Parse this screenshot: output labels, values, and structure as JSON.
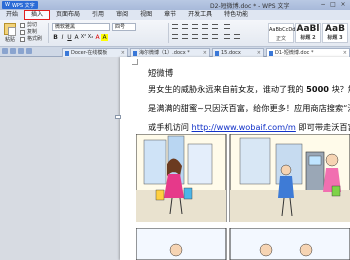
{
  "titlebar": {
    "app_name": "WPS 文字",
    "doc_title": "D2-短微博.doc * - WPS 文字",
    "min": "−",
    "max": "□",
    "close": "×"
  },
  "menu": {
    "items": [
      "开始",
      "插入",
      "页面布局",
      "引用",
      "审阅",
      "视图",
      "章节",
      "开发工具",
      "特色功能"
    ],
    "active_index": 1
  },
  "ribbon": {
    "paste_label": "粘贴",
    "cut_label": "剪切",
    "copy_label": "复制",
    "format_painter_label": "格式刷",
    "font_name": "微软雅黑",
    "font_size": "四号",
    "format_buttons": [
      "B",
      "I",
      "U",
      "A",
      "X²",
      "X₂",
      "A",
      "A"
    ],
    "styles": [
      {
        "preview": "AaBbCcDd",
        "name": "正文"
      },
      {
        "preview": "AaBbCcDd",
        "name": "标题 1"
      },
      {
        "preview": "AaBl",
        "name": "标题 2"
      },
      {
        "preview": "AaB",
        "name": "标题 3"
      }
    ]
  },
  "tabs": [
    {
      "label": "Docer-在线模板",
      "active": false
    },
    {
      "label": "海尔微博（1）.docx *",
      "active": false
    },
    {
      "label": "15.docx",
      "active": false
    },
    {
      "label": "D1-短微博.doc *",
      "active": true
    }
  ],
  "document": {
    "heading": "短微博",
    "line1_a": "男女生的威胁永远来自前女友，谁动了我的 ",
    "line1_num": "5000",
    "line1_b": " 块？解开你",
    "line2": "是满满的甜蜜~只因沃百富，给你更多！应用商店搜索“沃百富”",
    "line3_a": "或手机访问 ",
    "line3_link": "http://www.wobaif.com/m",
    "line3_b": " 即可带走沃百富君~"
  },
  "colors": {
    "accent": "#2b6bd6",
    "active_menu_border": "#e02020",
    "link": "#1232c8"
  }
}
